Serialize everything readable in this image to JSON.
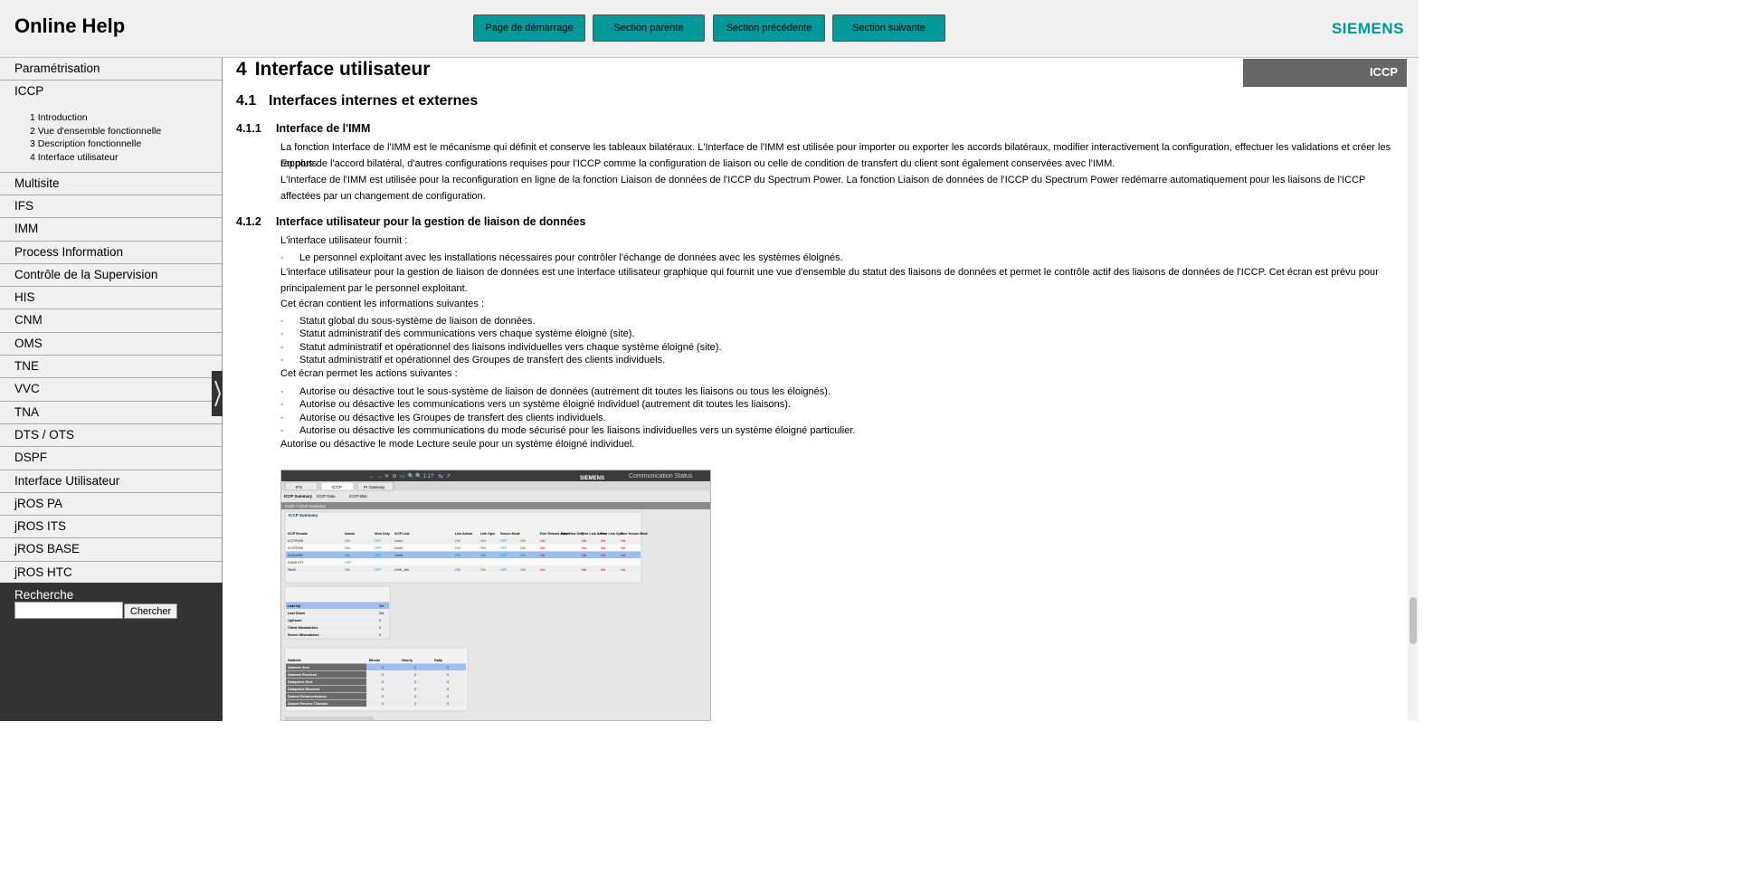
{
  "header": {
    "title": "Online Help",
    "nav_buttons": [
      "Page de démarrage",
      "Section parente",
      "Section précédente",
      "Section suivante"
    ],
    "logo": "SIEMENS",
    "brand_color": "#009999"
  },
  "sidebar": {
    "items_before": [
      "Paramétrisation"
    ],
    "active": {
      "label": "ICCP",
      "subitems": [
        "1 Introduction",
        "2 Vue d'ensemble fonctionnelle",
        "3 Description fonctionnelle",
        "4 Interface utilisateur"
      ]
    },
    "items_after": [
      "Multisite",
      "IFS",
      "IMM",
      "Process Information",
      "Contrôle de la Supervision",
      "HIS",
      "CNM",
      "OMS",
      "TNE",
      "VVC",
      "TNA",
      "DTS / OTS",
      "DSPF",
      "Interface Utilisateur",
      "jROS PA",
      "jROS ITS",
      "jROS BASE",
      "jROS HTC"
    ],
    "search": {
      "label": "Recherche",
      "button": "Chercher",
      "value": ""
    }
  },
  "content": {
    "tag": "ICCP",
    "h1": {
      "num": "4",
      "text": "Interface utilisateur"
    },
    "h2": {
      "num": "4.1",
      "text": "Interfaces internes et externes"
    },
    "s411": {
      "num": "4.1.1",
      "title": "Interface de l'IMM",
      "p1": "La fonction Interface de l'IMM est le mécanisme qui définit et conserve les tableaux bilatéraux. L'Interface de l'IMM est utilisée pour importer ou exporter les accords bilatéraux, modifier interactivement la configuration, effectuer les validations et créer les rapports.",
      "p2": "En plus de l'accord bilatéral, d'autres configurations requises pour l'ICCP comme la configuration de liaison ou celle de condition de transfert du client sont également conservées avec l'IMM.",
      "p3": "L'Interface de l'IMM est utilisée pour la reconfiguration en ligne de la fonction Liaison de données de l'ICCP du Spectrum Power. La fonction Liaison de données de l'ICCP du Spectrum Power redémarre automatiquement pour les liaisons de l'ICCP affectées par un changement de configuration."
    },
    "s412": {
      "num": "4.1.2",
      "title": "Interface utilisateur pour la gestion de liaison de données",
      "intro": "L'interface utilisateur fournit :",
      "intro_bullets": [
        "Le personnel exploitant avec les installations nécessaires pour contrôler l'échange de données avec les systèmes éloignés."
      ],
      "p_desc": "L'interface utilisateur pour la gestion de liaison de données est une interface utilisateur graphique qui fournit une vue d'ensemble du statut des liaisons de données et permet le contrôle actif des liaisons de données de l'ICCP. Cet écran est prévu pour principalement par le personnel exploitant.",
      "info_intro": "Cet écran contient les informations suivantes :",
      "info_bullets": [
        "Statut global du sous-système de liaison de données.",
        "Statut administratif des communications vers chaque système éloigné (site).",
        "Statut administratif et opérationnel des liaisons individuelles vers chaque système éloigné (site).",
        "Statut administratif et opérationnel des Groupes de transfert des clients individuels."
      ],
      "actions_intro": "Cet écran permet les actions suivantes :",
      "action_bullets": [
        "Autorise ou désactive tout le sous-système de liaison de données (autrement dit toutes les liaisons ou tous les éloignés).",
        "Autorise ou désactive les communications vers un système éloigné individuel (autrement dit toutes les liaisons).",
        "Autorise ou désactive les Groupes de transfert des clients individuels.",
        "Autorise ou désactive les communications du mode sécurisé pour les liaisons individuelles vers un système éloigné particulier."
      ],
      "last": "Autorise ou désactive le mode Lecture seule pour un système éloigné individuel."
    }
  },
  "screenshot": {
    "logo": "SIEMENS",
    "title": "Communication Status",
    "toolbar_glyphs": [
      "←",
      "→",
      "✕",
      "⊘",
      "▭",
      "🔍",
      "🔍",
      "1:1",
      "?",
      "⇆",
      "↗"
    ],
    "tabs": [
      "IFS",
      "ICCP",
      "PI Gateway"
    ],
    "subtabs": [
      "ICCP Summary",
      "ICCP Data",
      "ICCP Misc"
    ],
    "breadcrumb": "ICCP  >  ICCP Summary",
    "summary": {
      "title": "ICCP Summary",
      "columns": [
        "ICCP Remote",
        "Admin",
        "View Only",
        "ICCP Link",
        "Link Admin",
        "Link Oper",
        "Secure Mode",
        "",
        "Peer Remote Admin",
        "Peer View Only",
        "Peer Link Admin",
        "Peer Link Oper",
        "Peer Secure Mode"
      ],
      "rows": [
        [
          "ICCPEMS",
          "ON",
          "OFF",
          "Link1",
          "ON",
          "ON",
          "OFF",
          "ON",
          "NA",
          "",
          "NA",
          "NA",
          "NA"
        ],
        [
          "ICCPEMS",
          "ON",
          "OFF",
          "Link2",
          "ON",
          "ON",
          "OFF",
          "ON",
          "NA",
          "",
          "NA",
          "NA",
          "NA"
        ],
        [
          "SIGUARD",
          "ON",
          "OFF",
          "Link3",
          "ON",
          "ON",
          "OFF",
          "ON",
          "NA",
          "",
          "NA",
          "NA",
          "NA"
        ],
        [
          "SUBSYST",
          "OFF",
          "",
          "",
          "",
          "",
          "",
          "",
          "",
          "",
          "",
          "",
          ""
        ],
        [
          "SiteB",
          "ON",
          "OFF",
          "LINK_AB",
          "ON",
          "ON",
          "OFF",
          "ON",
          "NA",
          "",
          "NA",
          "NA",
          "NA"
        ]
      ]
    },
    "link_status": {
      "rows": [
        [
          "Last Up",
          "NA"
        ],
        [
          "Last Down",
          "NA"
        ],
        [
          "UpDown",
          "0"
        ],
        [
          "Client Mismatches",
          "0"
        ],
        [
          "Server Mismatches",
          "0"
        ]
      ]
    },
    "statistics": {
      "columns": [
        "Statistic",
        "Minute",
        "Hourly",
        "Daily"
      ],
      "rows": [
        [
          "Datasets Sent",
          "0",
          "0",
          "0"
        ],
        [
          "Datasets Received",
          "0",
          "0",
          "0"
        ],
        [
          "Datapoints Sent",
          "0",
          "0",
          "0"
        ],
        [
          "Datapoints Received",
          "0",
          "0",
          "0"
        ],
        [
          "Dataset Retransmissions",
          "0",
          "0",
          "0"
        ],
        [
          "Dataset Receive Timeouts",
          "0",
          "0",
          "0"
        ]
      ]
    }
  }
}
